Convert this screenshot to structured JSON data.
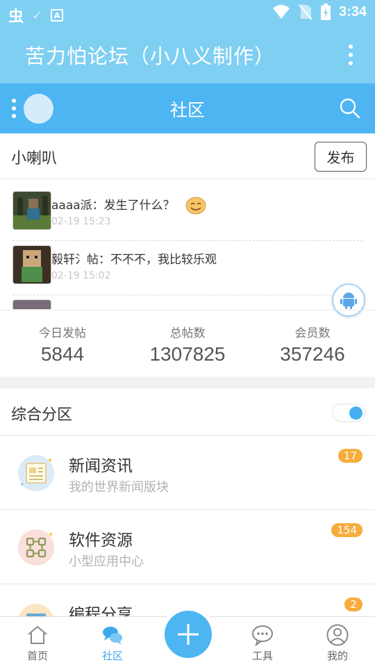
{
  "status_bar": {
    "app_icon_text": "虫",
    "time": "3:34"
  },
  "app_bar": {
    "title": "苦力怕论坛（小八义制作）"
  },
  "sub_bar": {
    "title": "社区"
  },
  "announcement": {
    "label": "小喇叭",
    "publish_label": "发布",
    "posts": [
      {
        "text": "aaaa派：发生了什么？",
        "time": "02-19 15:23"
      },
      {
        "text": "毅轩氵帖：不不不，我比较乐观",
        "time": "02-19 15:02"
      }
    ]
  },
  "stats": [
    {
      "label": "今日发帖",
      "value": "5844"
    },
    {
      "label": "总帖数",
      "value": "1307825"
    },
    {
      "label": "会员数",
      "value": "357246"
    }
  ],
  "section": {
    "label": "综合分区",
    "toggle_on": true,
    "forums": [
      {
        "name": "新闻资讯",
        "desc": "我的世界新闻版块",
        "badge": "17",
        "icon": "newspaper-icon"
      },
      {
        "name": "软件资源",
        "desc": "小型应用中心",
        "badge": "154",
        "icon": "apps-icon"
      },
      {
        "name": "编程分享",
        "desc": "",
        "badge": "2",
        "icon": "laptop-icon"
      }
    ]
  },
  "bottom_nav": {
    "items": [
      {
        "label": "首页",
        "icon": "home-icon"
      },
      {
        "label": "社区",
        "icon": "chat-icon"
      },
      {
        "label": "工具",
        "icon": "tools-icon"
      },
      {
        "label": "我的",
        "icon": "profile-icon"
      }
    ],
    "active": "社区"
  },
  "colors": {
    "app_bar": "#7fcff3",
    "sub_bar": "#4db5f2",
    "accent": "#3fa9ee",
    "badge": "#f7ad3c"
  }
}
